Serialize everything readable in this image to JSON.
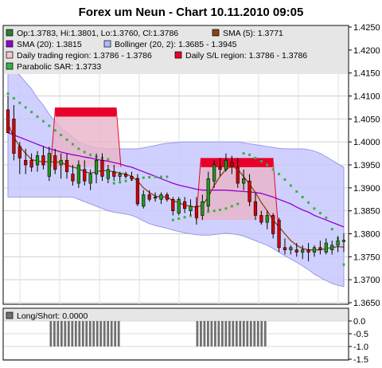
{
  "chart_data": [
    {
      "type": "candlestick",
      "title": "Forex um Neun - Chart 10.11.2010 09:05",
      "legend": [
        {
          "label": "Op:1.3783, Hi:1.3801, Lo:1.3760, Cl:1.3786",
          "color": "#2e7d32"
        },
        {
          "label": "SMA (5): 1.3771",
          "color": "#8b4513"
        },
        {
          "label": "SMA (20): 1.3815",
          "color": "#9400d3"
        },
        {
          "label": "Bollinger (20, 2): 1.3685 - 1.3945",
          "color": "#b0b8ff"
        },
        {
          "label": "Daily trading region: 1.3786 - 1.3786",
          "color": "#f2c6d0"
        },
        {
          "label": "Daily S/L region: 1.3786 - 1.3786",
          "color": "#e8002b"
        },
        {
          "label": "Parabolic SAR: 1.3733",
          "color": "#3cb043"
        }
      ],
      "ylim": [
        1.365,
        1.425
      ],
      "yticks": [
        "1.4250",
        "1.4200",
        "1.4150",
        "1.4100",
        "1.4050",
        "1.4000",
        "1.3950",
        "1.3900",
        "1.3850",
        "1.3800",
        "1.3750",
        "1.3700",
        "1.3650"
      ],
      "candles": [
        {
          "o": 1.407,
          "h": 1.41,
          "l": 1.402,
          "c": 1.402
        },
        {
          "o": 1.405,
          "h": 1.408,
          "l": 1.396,
          "c": 1.3975
        },
        {
          "o": 1.399,
          "h": 1.4,
          "l": 1.393,
          "c": 1.3965
        },
        {
          "o": 1.396,
          "h": 1.3985,
          "l": 1.393,
          "c": 1.395
        },
        {
          "o": 1.396,
          "h": 1.3975,
          "l": 1.3935,
          "c": 1.3945
        },
        {
          "o": 1.395,
          "h": 1.398,
          "l": 1.3935,
          "c": 1.397
        },
        {
          "o": 1.397,
          "h": 1.399,
          "l": 1.394,
          "c": 1.395
        },
        {
          "o": 1.3925,
          "h": 1.399,
          "l": 1.3915,
          "c": 1.3975
        },
        {
          "o": 1.397,
          "h": 1.3985,
          "l": 1.393,
          "c": 1.394
        },
        {
          "o": 1.395,
          "h": 1.3975,
          "l": 1.392,
          "c": 1.396
        },
        {
          "o": 1.396,
          "h": 1.3975,
          "l": 1.392,
          "c": 1.3935
        },
        {
          "o": 1.393,
          "h": 1.395,
          "l": 1.3905,
          "c": 1.3915
        },
        {
          "o": 1.391,
          "h": 1.396,
          "l": 1.39,
          "c": 1.395
        },
        {
          "o": 1.394,
          "h": 1.396,
          "l": 1.3905,
          "c": 1.3915
        },
        {
          "o": 1.391,
          "h": 1.394,
          "l": 1.3895,
          "c": 1.393
        },
        {
          "o": 1.393,
          "h": 1.3975,
          "l": 1.391,
          "c": 1.396
        },
        {
          "o": 1.396,
          "h": 1.3975,
          "l": 1.3915,
          "c": 1.3925
        },
        {
          "o": 1.392,
          "h": 1.395,
          "l": 1.391,
          "c": 1.394
        },
        {
          "o": 1.3935,
          "h": 1.395,
          "l": 1.3915,
          "c": 1.3925
        },
        {
          "o": 1.3925,
          "h": 1.3935,
          "l": 1.3915,
          "c": 1.393
        },
        {
          "o": 1.393,
          "h": 1.3935,
          "l": 1.392,
          "c": 1.3925
        },
        {
          "o": 1.3925,
          "h": 1.3935,
          "l": 1.3915,
          "c": 1.392
        },
        {
          "o": 1.392,
          "h": 1.393,
          "l": 1.386,
          "c": 1.3865
        },
        {
          "o": 1.386,
          "h": 1.3895,
          "l": 1.3855,
          "c": 1.3885
        },
        {
          "o": 1.3885,
          "h": 1.3895,
          "l": 1.387,
          "c": 1.3875
        },
        {
          "o": 1.388,
          "h": 1.389,
          "l": 1.387,
          "c": 1.388
        },
        {
          "o": 1.3875,
          "h": 1.389,
          "l": 1.3865,
          "c": 1.3885
        },
        {
          "o": 1.3885,
          "h": 1.389,
          "l": 1.387,
          "c": 1.3875
        },
        {
          "o": 1.3875,
          "h": 1.388,
          "l": 1.384,
          "c": 1.385
        },
        {
          "o": 1.3845,
          "h": 1.388,
          "l": 1.384,
          "c": 1.3875
        },
        {
          "o": 1.387,
          "h": 1.388,
          "l": 1.3845,
          "c": 1.3855
        },
        {
          "o": 1.385,
          "h": 1.3875,
          "l": 1.384,
          "c": 1.386
        },
        {
          "o": 1.386,
          "h": 1.388,
          "l": 1.382,
          "c": 1.3835
        },
        {
          "o": 1.384,
          "h": 1.3885,
          "l": 1.383,
          "c": 1.387
        },
        {
          "o": 1.386,
          "h": 1.3935,
          "l": 1.385,
          "c": 1.392
        },
        {
          "o": 1.3915,
          "h": 1.396,
          "l": 1.39,
          "c": 1.395
        },
        {
          "o": 1.3945,
          "h": 1.3965,
          "l": 1.3925,
          "c": 1.394
        },
        {
          "o": 1.394,
          "h": 1.3975,
          "l": 1.3935,
          "c": 1.396
        },
        {
          "o": 1.3955,
          "h": 1.397,
          "l": 1.393,
          "c": 1.3945
        },
        {
          "o": 1.3945,
          "h": 1.3965,
          "l": 1.39,
          "c": 1.391
        },
        {
          "o": 1.391,
          "h": 1.394,
          "l": 1.3895,
          "c": 1.392
        },
        {
          "o": 1.3915,
          "h": 1.393,
          "l": 1.386,
          "c": 1.387
        },
        {
          "o": 1.387,
          "h": 1.389,
          "l": 1.383,
          "c": 1.384
        },
        {
          "o": 1.384,
          "h": 1.385,
          "l": 1.382,
          "c": 1.3825
        },
        {
          "o": 1.3825,
          "h": 1.385,
          "l": 1.381,
          "c": 1.384
        },
        {
          "o": 1.384,
          "h": 1.3845,
          "l": 1.379,
          "c": 1.38
        },
        {
          "o": 1.383,
          "h": 1.3835,
          "l": 1.376,
          "c": 1.377
        },
        {
          "o": 1.377,
          "h": 1.379,
          "l": 1.3755,
          "c": 1.3765
        },
        {
          "o": 1.3765,
          "h": 1.3775,
          "l": 1.3755,
          "c": 1.377
        },
        {
          "o": 1.3765,
          "h": 1.378,
          "l": 1.375,
          "c": 1.376
        },
        {
          "o": 1.376,
          "h": 1.3775,
          "l": 1.3745,
          "c": 1.3765
        },
        {
          "o": 1.3765,
          "h": 1.378,
          "l": 1.374,
          "c": 1.376
        },
        {
          "o": 1.376,
          "h": 1.3775,
          "l": 1.375,
          "c": 1.377
        },
        {
          "o": 1.377,
          "h": 1.3785,
          "l": 1.3755,
          "c": 1.3765
        },
        {
          "o": 1.376,
          "h": 1.379,
          "l": 1.3755,
          "c": 1.378
        },
        {
          "o": 1.3765,
          "h": 1.3785,
          "l": 1.3755,
          "c": 1.3775
        },
        {
          "o": 1.3775,
          "h": 1.3795,
          "l": 1.376,
          "c": 1.3785
        },
        {
          "o": 1.3783,
          "h": 1.3801,
          "l": 1.376,
          "c": 1.3786
        }
      ],
      "sma5": [
        1.404,
        1.401,
        1.399,
        1.3975,
        1.3962,
        1.3958,
        1.3957,
        1.3957,
        1.3957,
        1.3955,
        1.395,
        1.3945,
        1.3942,
        1.3935,
        1.3932,
        1.3935,
        1.3938,
        1.3937,
        1.3935,
        1.3932,
        1.393,
        1.3925,
        1.3915,
        1.39,
        1.389,
        1.3882,
        1.388,
        1.388,
        1.3872,
        1.3868,
        1.3862,
        1.386,
        1.3858,
        1.3862,
        1.388,
        1.3905,
        1.3925,
        1.394,
        1.3948,
        1.394,
        1.3925,
        1.3908,
        1.389,
        1.3868,
        1.385,
        1.383,
        1.3815,
        1.38,
        1.3785,
        1.3775,
        1.3768,
        1.3765,
        1.3765,
        1.3765,
        1.3768,
        1.377,
        1.3772,
        1.3771
      ],
      "sma20": [
        1.402,
        1.4015,
        1.401,
        1.4005,
        1.4,
        1.3995,
        1.399,
        1.3985,
        1.3982,
        1.3978,
        1.3975,
        1.3972,
        1.397,
        1.3967,
        1.3965,
        1.3962,
        1.396,
        1.3958,
        1.3955,
        1.3952,
        1.3948,
        1.3945,
        1.394,
        1.3935,
        1.393,
        1.3925,
        1.392,
        1.3915,
        1.391,
        1.3906,
        1.3903,
        1.39,
        1.3897,
        1.3895,
        1.3895,
        1.3895,
        1.3895,
        1.3895,
        1.3894,
        1.3893,
        1.3892,
        1.3891,
        1.389,
        1.3888,
        1.3884,
        1.388,
        1.3875,
        1.387,
        1.3865,
        1.3858,
        1.3852,
        1.3847,
        1.384,
        1.3835,
        1.383,
        1.3825,
        1.382,
        1.3815
      ],
      "bb_upper": [
        1.416,
        1.4155,
        1.4145,
        1.413,
        1.4115,
        1.4095,
        1.408,
        1.406,
        1.4045,
        1.403,
        1.402,
        1.401,
        1.4,
        1.3995,
        1.399,
        1.3987,
        1.3985,
        1.3985,
        1.3985,
        1.3985,
        1.3985,
        1.3985,
        1.3985,
        1.3987,
        1.399,
        1.3992,
        1.3995,
        1.3997,
        1.3998,
        1.3999,
        1.4,
        1.4,
        1.4,
        1.4,
        1.4,
        1.4,
        1.4,
        1.4,
        1.4,
        1.4,
        1.3998,
        1.3996,
        1.3994,
        1.3992,
        1.399,
        1.3988,
        1.3986,
        1.3985,
        1.3985,
        1.3985,
        1.3985,
        1.3983,
        1.398,
        1.3975,
        1.3968,
        1.396,
        1.3952,
        1.3945
      ],
      "bb_lower": [
        1.388,
        1.388,
        1.388,
        1.388,
        1.388,
        1.388,
        1.388,
        1.388,
        1.388,
        1.388,
        1.388,
        1.388,
        1.3875,
        1.387,
        1.3865,
        1.386,
        1.3855,
        1.385,
        1.3847,
        1.3845,
        1.3843,
        1.384,
        1.3835,
        1.3828,
        1.3822,
        1.3818,
        1.3815,
        1.3812,
        1.3808,
        1.3805,
        1.3802,
        1.38,
        1.3798,
        1.3797,
        1.3797,
        1.3798,
        1.38,
        1.3801,
        1.38,
        1.3798,
        1.3795,
        1.379,
        1.3785,
        1.378,
        1.3775,
        1.3768,
        1.376,
        1.3752,
        1.3745,
        1.3738,
        1.373,
        1.3722,
        1.3712,
        1.3705,
        1.3698,
        1.3692,
        1.3688,
        1.3685
      ],
      "sar": [
        1.4105,
        1.4095,
        1.4085,
        1.4075,
        1.4065,
        1.4055,
        1.4045,
        1.4035,
        1.4025,
        1.4015,
        1.4005,
        1.3995,
        1.3985,
        1.3978,
        1.3972,
        1.3968,
        1.3965,
        1.3962,
        1.391,
        1.3912,
        1.3915,
        1.3918,
        1.392,
        1.3922,
        1.3923,
        1.3924,
        1.3924,
        1.3924,
        1.383,
        1.3833,
        1.3836,
        1.3839,
        1.3842,
        1.3845,
        1.3848,
        1.385,
        1.3852,
        1.3855,
        1.386,
        1.3865,
        1.3975,
        1.3972,
        1.3965,
        1.3958,
        1.395,
        1.394,
        1.393,
        1.3918,
        1.3905,
        1.3892,
        1.388,
        1.3868,
        1.3855,
        1.3845,
        1.3835,
        1.381,
        1.379,
        1.3733
      ],
      "trading_regions": [
        {
          "from": 11,
          "to": 29,
          "high": 1.4075,
          "mid": 1.4055,
          "low": 1.398
        },
        {
          "from": 50,
          "to": 71,
          "high": 1.3965,
          "mid": 1.3945,
          "low": 1.3865
        }
      ]
    },
    {
      "type": "bar",
      "legend": [
        {
          "label": "Long/Short: 0.0000",
          "color": "#707070"
        }
      ],
      "ylim": [
        -1.5,
        0.0
      ],
      "yticks": [
        "0.0",
        "-0.5",
        "-1.0",
        "-1.5"
      ],
      "values": [
        0,
        0,
        0,
        0,
        0,
        0,
        0,
        0,
        0,
        0,
        0,
        0,
        -1,
        -1,
        -1,
        -1,
        -1,
        -1,
        -1,
        -1,
        -1,
        -1,
        -1,
        -1,
        -1,
        -1,
        -1,
        -1,
        -1,
        -1,
        -1,
        -1,
        0,
        0,
        0,
        0,
        0,
        0,
        0,
        0,
        0,
        0,
        0,
        0,
        0,
        0,
        0,
        0,
        0,
        0,
        0,
        0,
        0,
        -1,
        -1,
        -1,
        -1,
        -1,
        -1,
        -1,
        -1,
        -1,
        -1,
        -1,
        -1,
        -1,
        -1,
        -1,
        -1,
        -1,
        -1,
        -1,
        -1,
        0,
        0,
        0,
        0,
        0,
        0,
        0,
        0,
        0,
        0,
        0,
        0,
        0,
        0,
        0,
        0,
        0,
        0,
        0,
        0,
        0,
        0
      ]
    }
  ]
}
